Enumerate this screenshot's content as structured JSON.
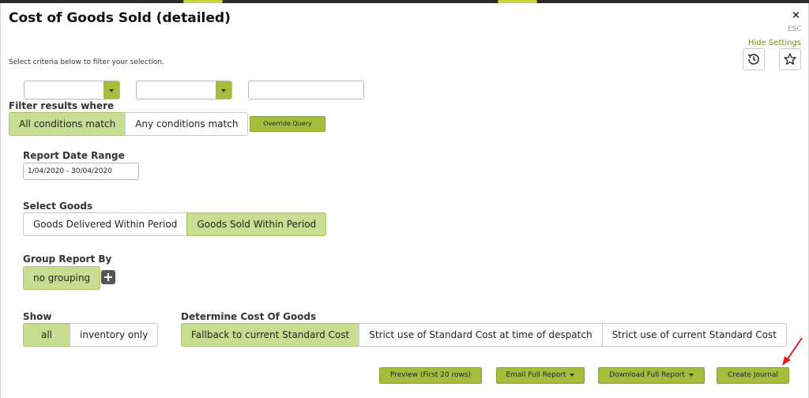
{
  "header": {
    "title": "Cost of Goods Sold (detailed)",
    "close_label": "×",
    "esc_label": "ESC",
    "hide_settings_label": "Hide Settings"
  },
  "icons": {
    "history": "history-icon",
    "favourite": "star-icon"
  },
  "subtitle": "Select criteria below to filter your selection.",
  "filters": {
    "select_1_value": "",
    "select_2_value": "",
    "text_value": "",
    "label": "Filter results where",
    "options": [
      "All conditions match",
      "Any conditions match"
    ],
    "selected": "All conditions match",
    "override_label": "Override Query"
  },
  "report_date_range": {
    "label": "Report Date Range",
    "value": "1/04/2020 - 30/04/2020"
  },
  "select_goods": {
    "label": "Select Goods",
    "options": [
      "Goods Delivered Within Period",
      "Goods Sold Within Period"
    ],
    "selected": "Goods Sold Within Period"
  },
  "group_report_by": {
    "label": "Group Report By",
    "value": "no grouping"
  },
  "show": {
    "label": "Show",
    "options": [
      "all",
      "inventory only"
    ],
    "selected": "all"
  },
  "determine_cost": {
    "label": "Determine Cost Of Goods",
    "options": [
      "Fallback to current Standard Cost",
      "Strict use of Standard Cost at time of despatch",
      "Strict use of current Standard Cost"
    ],
    "selected": "Fallback to current Standard Cost"
  },
  "actions": {
    "preview": "Preview (First 20 rows)",
    "email": "Email Full Report",
    "download": "Download Full Report",
    "create_journal": "Create Journal"
  },
  "colors": {
    "accent": "#a4be3c",
    "selected": "#c7de92",
    "link": "#6f8f16",
    "annotation": "#e02020"
  }
}
